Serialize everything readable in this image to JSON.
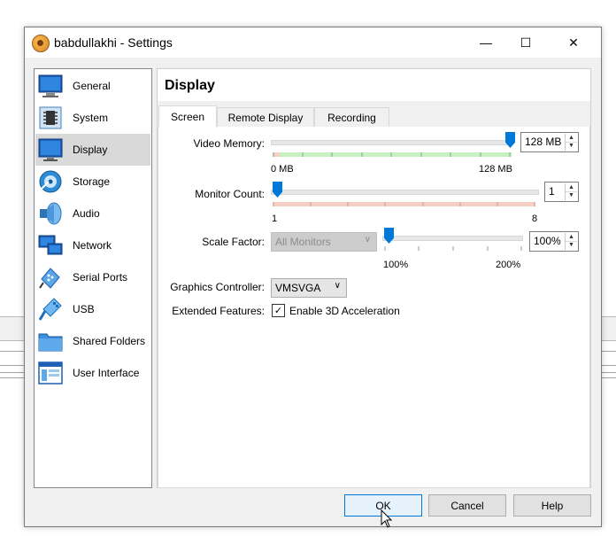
{
  "window": {
    "title": "babdullakhi - Settings",
    "minimize_glyph": "—",
    "maximize_glyph": "☐",
    "close_glyph": "✕"
  },
  "nav": {
    "items": [
      {
        "label": "General",
        "icon": "monitor-icon",
        "selected": false
      },
      {
        "label": "System",
        "icon": "chip-icon",
        "selected": false
      },
      {
        "label": "Display",
        "icon": "display-icon",
        "selected": true
      },
      {
        "label": "Storage",
        "icon": "disk-icon",
        "selected": false
      },
      {
        "label": "Audio",
        "icon": "speaker-icon",
        "selected": false
      },
      {
        "label": "Network",
        "icon": "network-icon",
        "selected": false
      },
      {
        "label": "Serial Ports",
        "icon": "serial-port-icon",
        "selected": false
      },
      {
        "label": "USB",
        "icon": "usb-icon",
        "selected": false
      },
      {
        "label": "Shared Folders",
        "icon": "folder-icon",
        "selected": false
      },
      {
        "label": "User Interface",
        "icon": "window-icon",
        "selected": false
      }
    ]
  },
  "section": {
    "title": "Display"
  },
  "tabs": [
    {
      "label": "Screen",
      "active": true
    },
    {
      "label": "Remote Display",
      "active": false
    },
    {
      "label": "Recording",
      "active": false
    }
  ],
  "screen": {
    "video_memory": {
      "label": "Video Memory:",
      "value": "128 MB",
      "min_label": "0 MB",
      "max_label": "128 MB",
      "level": 1.0
    },
    "monitor_count": {
      "label": "Monitor Count:",
      "value": "1",
      "min_label": "1",
      "max_label": "8",
      "level": 0.0
    },
    "scale_factor": {
      "label": "Scale Factor:",
      "combo_value": "All Monitors",
      "value": "100%",
      "min_label": "100%",
      "max_label": "200%",
      "level": 0.0
    },
    "graphics_controller": {
      "label": "Graphics Controller:",
      "value": "VMSVGA"
    },
    "extended_features": {
      "label": "Extended Features:",
      "checkbox_label": "Enable 3D Acceleration",
      "checked": true,
      "check_glyph": "✓"
    }
  },
  "buttons": {
    "ok": "OK",
    "cancel": "Cancel",
    "help": "Help"
  },
  "colors": {
    "accent": "#0078d7",
    "green_zone": "#c9f0c0",
    "red_zone": "#f6cfc4",
    "selected_nav": "#d9d9d9"
  },
  "glyphs": {
    "spin_up": "▲",
    "spin_down": "▼",
    "combo_arrow": "∨"
  }
}
